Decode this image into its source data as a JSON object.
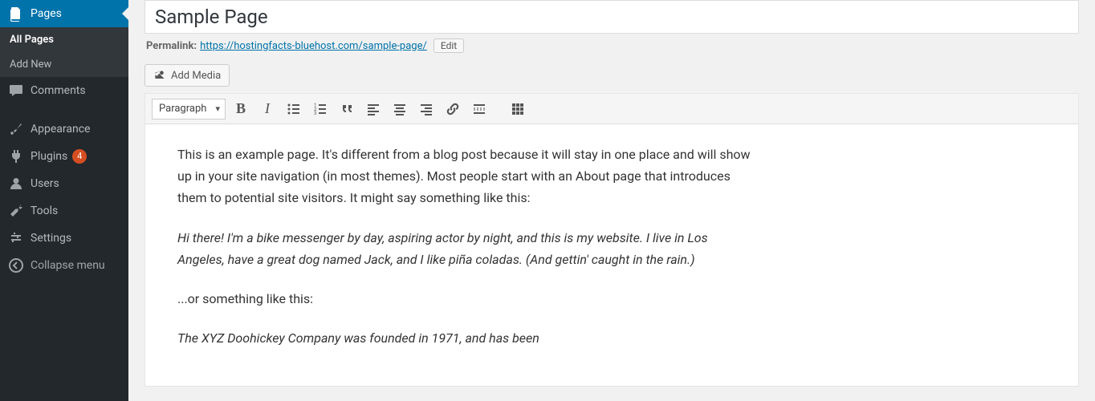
{
  "sidebar": {
    "pages": {
      "label": "Pages"
    },
    "pages_sub": {
      "all": "All Pages",
      "add": "Add New"
    },
    "comments": {
      "label": "Comments"
    },
    "appearance": {
      "label": "Appearance"
    },
    "plugins": {
      "label": "Plugins",
      "badge": "4"
    },
    "users": {
      "label": "Users"
    },
    "tools": {
      "label": "Tools"
    },
    "settings": {
      "label": "Settings"
    },
    "collapse": {
      "label": "Collapse menu"
    }
  },
  "title": "Sample Page",
  "permalink": {
    "label": "Permalink:",
    "url": "https://hostingfacts-bluehost.com/sample-page/",
    "edit": "Edit"
  },
  "media_btn": "Add Media",
  "format_select": "Paragraph",
  "content": {
    "p1": "This is an example page. It's different from a blog post because it will stay in one place and will show up in your site navigation (in most themes). Most people start with an About page that introduces them to potential site visitors. It might say something like this:",
    "p2_italic": "Hi there! I'm a bike messenger by day, aspiring actor by night, and this is my website. I live in Los Angeles, have a great dog named Jack, and I like piña coladas. (And gettin' caught in the rain.)",
    "p3": "...or something like this:",
    "p4_italic": "The XYZ Doohickey Company was founded in 1971, and has been"
  }
}
